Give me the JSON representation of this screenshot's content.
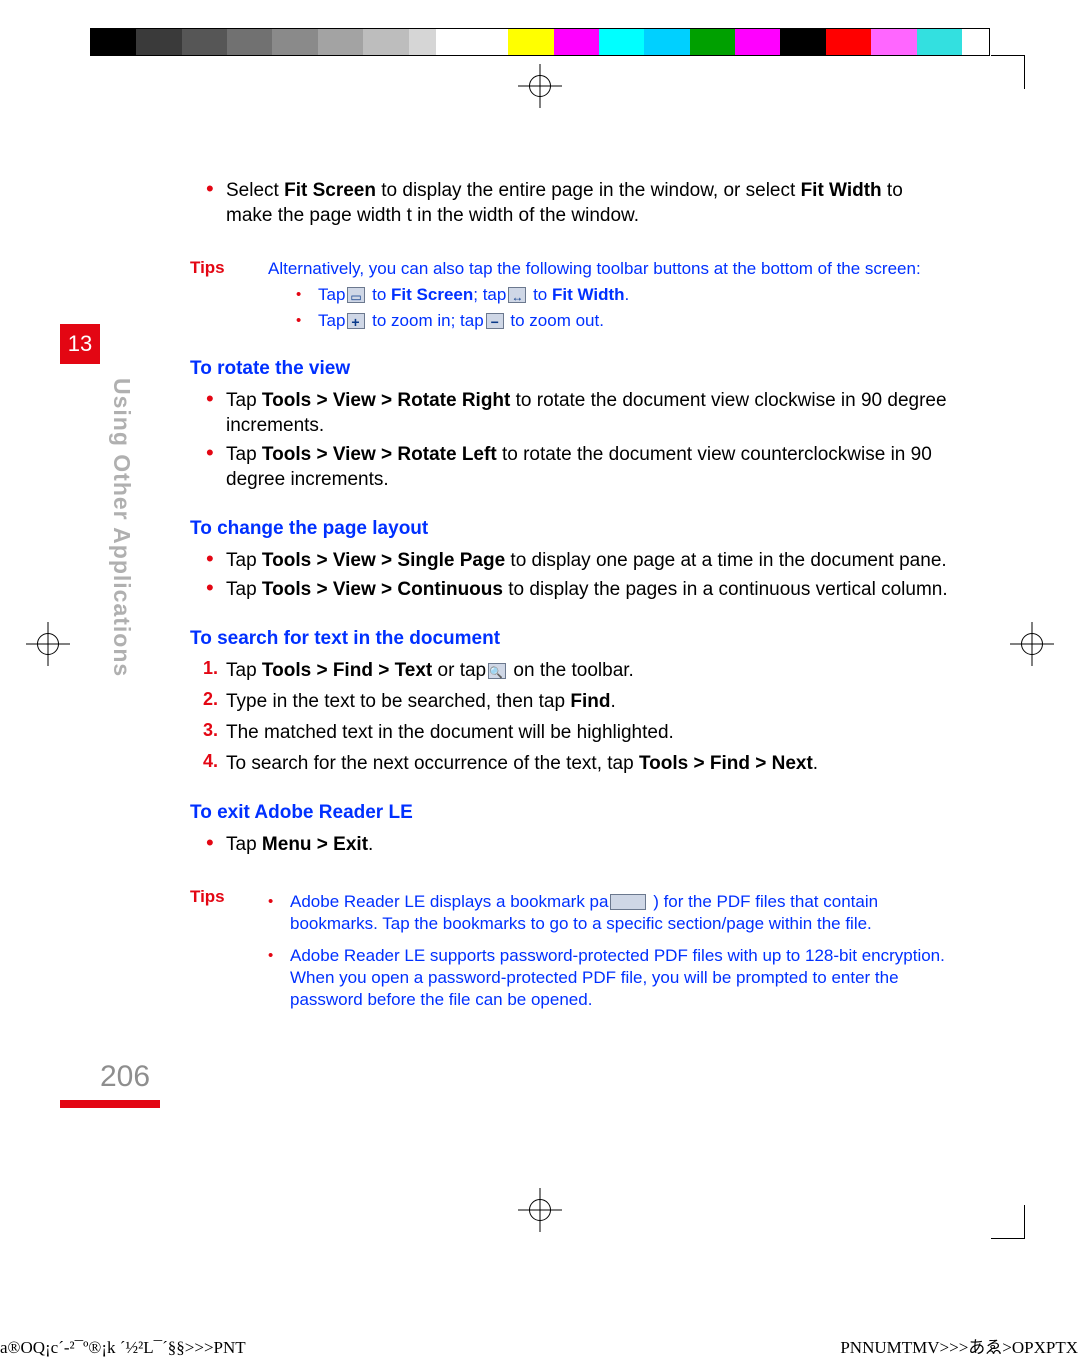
{
  "chapter": {
    "number": "13",
    "title": "Using Other Applications"
  },
  "page_number": "206",
  "intro_bullet": {
    "pre": "Select ",
    "b1": "Fit Screen",
    "mid1": " to display the entire page in the window, or select ",
    "b2": "Fit Width",
    "mid2": " to make the page width  t in the width of the window."
  },
  "tips1": {
    "label": "Tips",
    "lead": "Alternatively, you can also tap the following toolbar buttons at the bottom of the screen:",
    "row1_a": "Tap",
    "row1_b": " to ",
    "row1_c": "Fit Screen",
    "row1_d": "; tap",
    "row1_e": " to ",
    "row1_f": "Fit Width",
    "row1_g": ".",
    "row2_a": "Tap",
    "row2_b": " to zoom in; tap",
    "row2_c": " to zoom out."
  },
  "rotate": {
    "heading": "To rotate the view",
    "b1_pre": "Tap ",
    "b1_bold": "Tools > View > Rotate Right",
    "b1_post": " to rotate the document view clockwise in 90 degree increments.",
    "b2_pre": "Tap ",
    "b2_bold": "Tools > View > Rotate Left",
    "b2_post": " to rotate the document view counterclockwise in 90 degree increments."
  },
  "layout": {
    "heading": "To change the page layout",
    "b1_pre": "Tap ",
    "b1_bold": "Tools > View > Single Page",
    "b1_post": " to display one page at a time in the document pane.",
    "b2_pre": "Tap ",
    "b2_bold": "Tools > View > Continuous",
    "b2_post": " to display the pages in a continuous vertical column."
  },
  "search": {
    "heading": "To search for text in the document",
    "s1_pre": "Tap ",
    "s1_bold": "Tools > Find > Text",
    "s1_mid": " or tap",
    "s1_post": " on the toolbar.",
    "s2_pre": "Type in the text to be searched, then tap ",
    "s2_bold": "Find",
    "s2_post": ".",
    "s3": "The matched text in the document will be highlighted.",
    "s4_pre": "To search for the next occurrence of the text, tap ",
    "s4_bold": "Tools > Find > Next",
    "s4_post": "."
  },
  "exit": {
    "heading": "To exit Adobe Reader LE",
    "pre": "Tap ",
    "bold": "Menu > Exit",
    "post": "."
  },
  "tips2": {
    "label": "Tips",
    "t1_a": "Adobe Reader LE displays a bookmark pa",
    "t1_b": " ) for the PDF files that contain bookmarks. Tap the bookmarks to go to a specific section/page within the file.",
    "t2": "Adobe Reader LE supports password-protected PDF files with up to 128-bit encryption. When you open a password-protected PDF file, you will be prompted to enter the password before the file can be opened."
  },
  "footer": {
    "left": "a®OQ¡c´-²¯º®¡k ´½²L¯´§§>>>PNT",
    "right": "PNNUMTMV>>>あゑ>OPXPTX"
  },
  "colorbar": [
    "#000000",
    "#3a3a3a",
    "#565656",
    "#717171",
    "#8a8a8a",
    "#a3a3a3",
    "#bdbdbd",
    "#d6d6d6",
    "#ffffff",
    "#ffffff",
    "#ffff00",
    "#ff00ff",
    "#00ffff",
    "#00d0ff",
    "#00a000",
    "#ff00ff",
    "#000000",
    "#ff0000",
    "#ff66ff",
    "#33e0e0",
    "#ffffff"
  ]
}
